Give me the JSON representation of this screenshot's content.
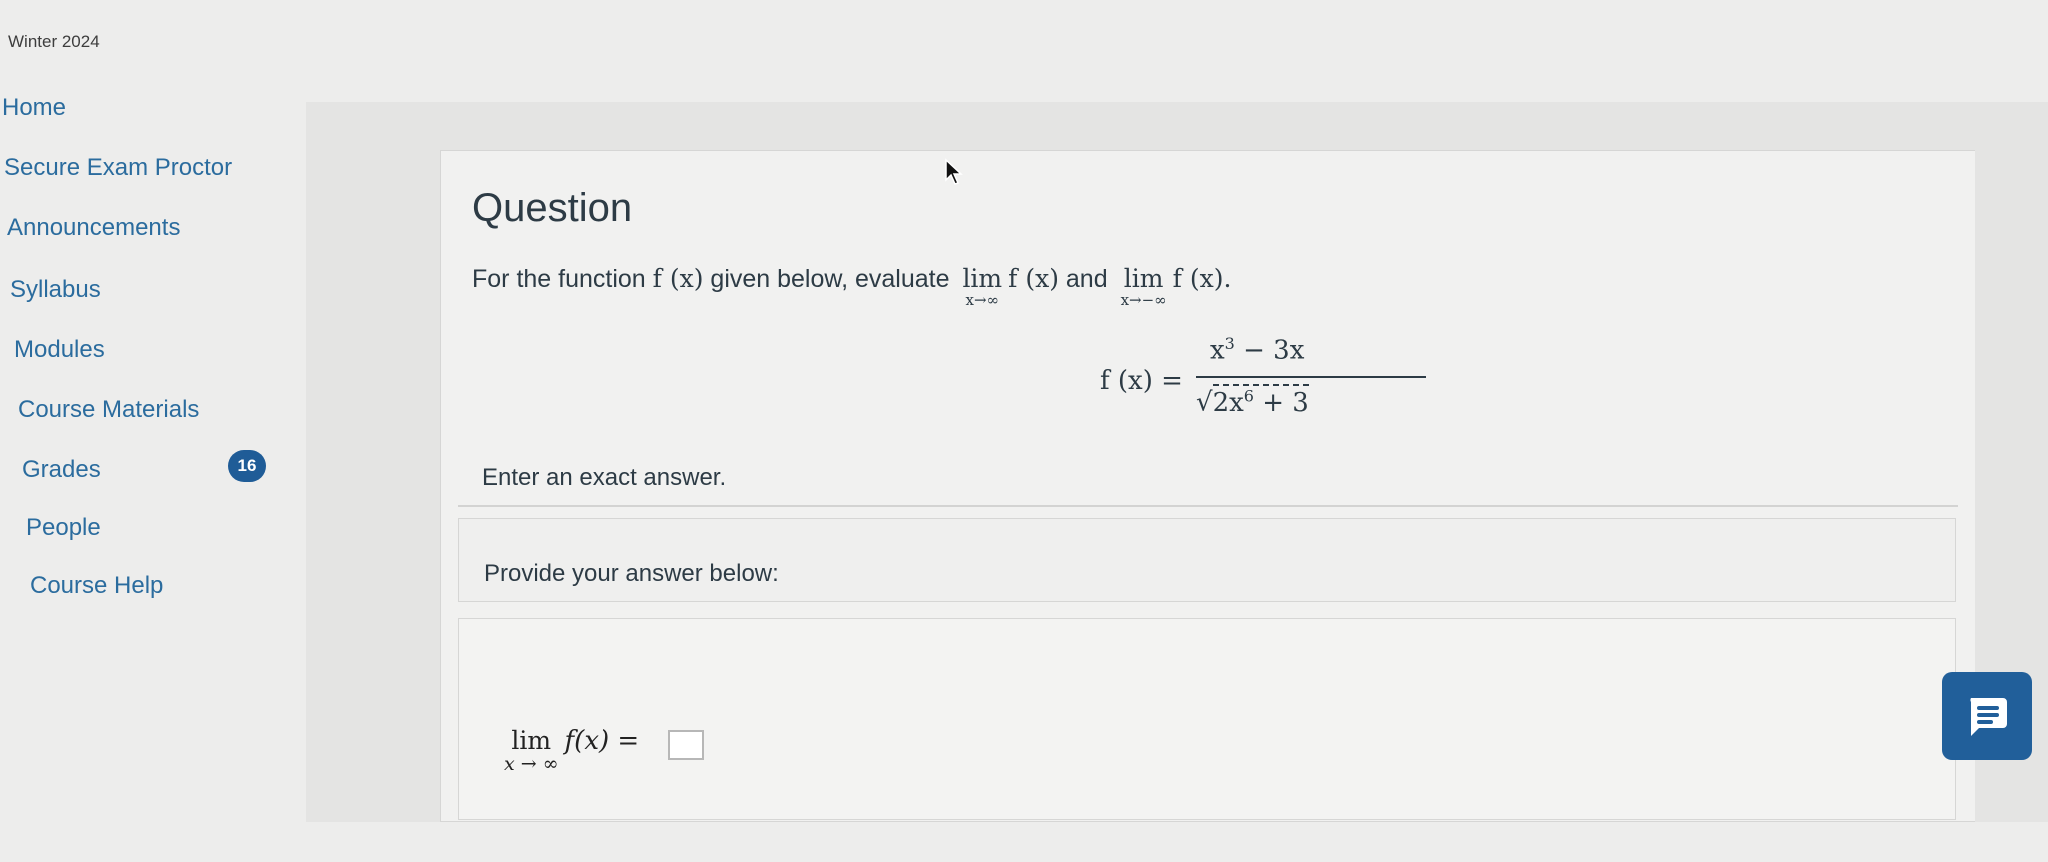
{
  "term": "Winter 2024",
  "nav": {
    "items": [
      {
        "label": "Home"
      },
      {
        "label": "Secure Exam Proctor"
      },
      {
        "label": "Announcements"
      },
      {
        "label": "Syllabus"
      },
      {
        "label": "Modules"
      },
      {
        "label": "Course Materials"
      },
      {
        "label": "Grades",
        "badge": "16"
      },
      {
        "label": "People"
      },
      {
        "label": "Course Help"
      }
    ]
  },
  "question": {
    "title": "Question",
    "text_prefix": "For the function ",
    "fx": "f (x)",
    "text_mid": " given below, evaluate ",
    "lim1_word": "lim",
    "lim1_sub": "x→∞",
    "lim1_expr": "f (x)",
    "and": " and ",
    "lim2_word": "lim",
    "lim2_sub": "x→−∞",
    "lim2_expr": "f (x).",
    "formula_lhs": "f (x) =",
    "formula_num": "x",
    "formula_num_exp": "3",
    "formula_num_rest": " − 3x",
    "formula_den_sqrt": "√",
    "formula_den_a": "2x",
    "formula_den_exp": "6",
    "formula_den_rest": " + 3",
    "hint": "Enter an exact answer."
  },
  "answer": {
    "label": "Provide your answer below:",
    "lim_word": "lim",
    "lim_sub": "x → ∞",
    "expr": "f(x) ="
  },
  "colors": {
    "nav_link": "#2b6c9e",
    "badge": "#1f5c97",
    "chat_button": "#215f9a"
  }
}
